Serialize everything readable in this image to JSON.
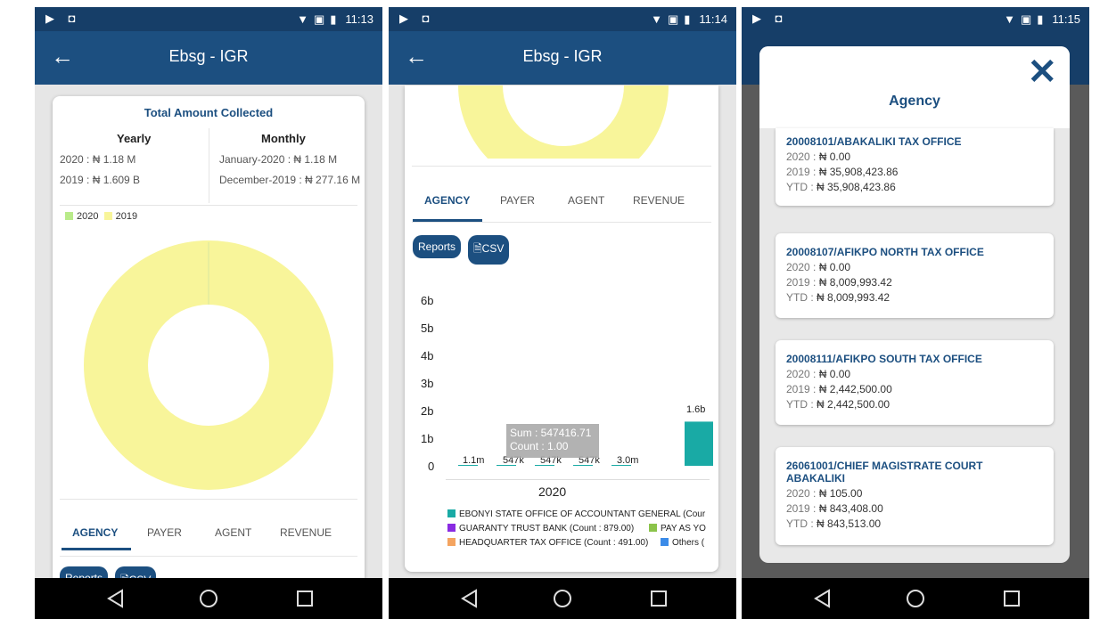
{
  "status": {
    "left_icons": "▶ ◘",
    "phone1_time": "11:13",
    "phone2_time": "11:14",
    "phone3_time": "11:15"
  },
  "app": {
    "title": "Ebsg - IGR",
    "back_icon": "arrow-left-icon"
  },
  "summary": {
    "title": "Total Amount Collected",
    "yearly_header": "Yearly",
    "monthly_header": "Monthly",
    "yearly": [
      "2020 : ₦ 1.18 M",
      "2019 : ₦ 1.609 B"
    ],
    "monthly": [
      "January-2020 : ₦ 1.18 M",
      "December-2019 : ₦ 277.16 M"
    ]
  },
  "donut": {
    "legend": [
      {
        "label": "2020",
        "color": "#b9eb8a"
      },
      {
        "label": "2019",
        "color": "#f8f59a"
      }
    ],
    "values": [
      1.18,
      1609
    ]
  },
  "tabs": [
    "AGENCY",
    "PAYER",
    "AGENT",
    "REVENUE"
  ],
  "buttons": {
    "reports": "Reports",
    "csv": "CSV"
  },
  "chart_data": {
    "type": "bar",
    "xlabel": "2020",
    "y_ticks": [
      "0",
      "1b",
      "2b",
      "3b",
      "4b",
      "5b",
      "6b"
    ],
    "ylim": [
      0,
      6000000000
    ],
    "bars": [
      {
        "label": "1.1m",
        "value": 1100000
      },
      {
        "label": "547k",
        "value": 547000
      },
      {
        "label": "547k",
        "value": 547000
      },
      {
        "label": "547k",
        "value": 547000
      },
      {
        "label": "3.0m",
        "value": 3000000
      },
      {
        "label": "1.6b",
        "value": 1600000000,
        "color": "#19aaa5"
      }
    ],
    "tooltip": [
      "Sum : 547416.71",
      "Count : 1.00"
    ],
    "legend": [
      {
        "label": "EBONYI STATE OFFICE OF ACCOUNTANT GENERAL (Cour",
        "color": "#19aaa5"
      },
      {
        "label": "GUARANTY TRUST BANK (Count : 879.00)",
        "color": "#8a2be2"
      },
      {
        "label": "PAY AS YO",
        "color": "#8bc34a"
      },
      {
        "label": "HEADQUARTER TAX OFFICE (Count : 491.00)",
        "color": "#f4a460"
      },
      {
        "label": "Others (",
        "color": "#3b8be8"
      }
    ]
  },
  "agency_modal": {
    "title": "Agency",
    "close_icon": "close-icon",
    "items": [
      {
        "name": "20008101/ABAKALIKI TAX OFFICE",
        "y2020": "₦ 0.00",
        "y2019": "₦ 35,908,423.86",
        "ytd": "₦ 35,908,423.86"
      },
      {
        "name": "20008107/AFIKPO NORTH TAX OFFICE",
        "y2020": "₦ 0.00",
        "y2019": "₦ 8,009,993.42",
        "ytd": "₦ 8,009,993.42"
      },
      {
        "name": "20008111/AFIKPO SOUTH TAX OFFICE",
        "y2020": "₦ 0.00",
        "y2019": "₦ 2,442,500.00",
        "ytd": "₦ 2,442,500.00"
      },
      {
        "name": "26061001/CHIEF MAGISTRATE COURT ABAKALIKI",
        "y2020": "₦ 105.00",
        "y2019": "₦ 843,408.00",
        "ytd": "₦ 843,513.00"
      }
    ],
    "label_2020": "2020 : ",
    "label_2019": "2019 : ",
    "label_ytd": "YTD : "
  }
}
